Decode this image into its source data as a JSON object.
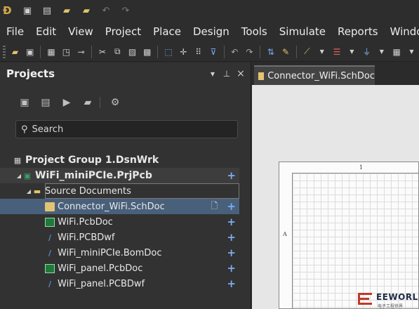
{
  "titlebar": {
    "buttons": [
      {
        "name": "app-logo-icon",
        "glyph": "D"
      },
      {
        "name": "save-icon",
        "glyph": "💾"
      },
      {
        "name": "save-all-icon",
        "glyph": "🗐"
      },
      {
        "name": "open-folder-icon",
        "glyph": "📂"
      },
      {
        "name": "open-project-icon",
        "glyph": "🗁"
      },
      {
        "name": "undo-icon",
        "glyph": "↶"
      },
      {
        "name": "redo-icon",
        "glyph": "↷"
      }
    ]
  },
  "menu": {
    "items": [
      "File",
      "Edit",
      "View",
      "Project",
      "Place",
      "Design",
      "Tools",
      "Simulate",
      "Reports",
      "Window"
    ]
  },
  "toolbar": {
    "icons": [
      "open-icon",
      "save-icon",
      "print-preview-icon",
      "zoom-icon",
      "cross-probe-icon",
      "cut-icon",
      "copy-icon",
      "paste-icon",
      "rubber-stamp-icon",
      "select-area-icon",
      "move-icon",
      "select-icon",
      "clear-filter-icon",
      "undo-icon",
      "redo-icon",
      "net-color-icon",
      "highlight-icon",
      "wire-icon",
      "bus-icon",
      "power-port-icon",
      "grid-icon"
    ]
  },
  "projects_panel": {
    "title": "Projects",
    "header_buttons": {
      "menu": "▼",
      "pin": "⊥",
      "close": "×"
    },
    "search_placeholder": "Search",
    "tree": {
      "group": "Project Group 1.DsnWrk",
      "project": "WiFi_miniPCIe.PrjPcb",
      "folder": "Source Documents",
      "files": [
        {
          "label": "Connector_WiFi.SchDoc",
          "type": "sch",
          "selected": true
        },
        {
          "label": "WiFi.PcbDoc",
          "type": "pcb",
          "selected": false
        },
        {
          "label": "WiFi.PCBDwf",
          "type": "pcbdwf",
          "selected": false
        },
        {
          "label": "WiFi_miniPCIe.BomDoc",
          "type": "bom",
          "selected": false
        },
        {
          "label": "WiFi_panel.PcbDoc",
          "type": "pcb",
          "selected": false
        },
        {
          "label": "WiFi_panel.PCBDwf",
          "type": "pcbdwf",
          "selected": false
        }
      ],
      "add_glyph": "+"
    }
  },
  "document": {
    "tab_label": "Connector_WiFi.SchDoc",
    "zone_top": "1",
    "zone_left": "A"
  },
  "watermark": {
    "text": "EEWORLD",
    "sub": "电子工程世界"
  },
  "colors": {
    "selection": "#49607b",
    "plus": "#7aaef5",
    "schdoc": "#e3c472"
  }
}
